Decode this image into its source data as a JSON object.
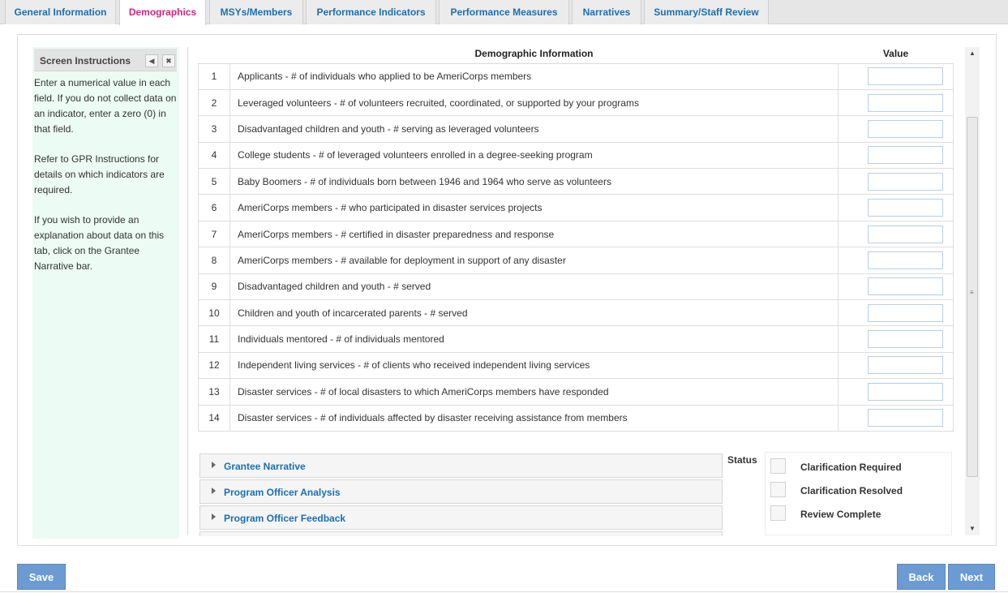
{
  "tabs": [
    {
      "label": "General Information",
      "active": false
    },
    {
      "label": "Demographics",
      "active": true
    },
    {
      "label": "MSYs/Members",
      "active": false
    },
    {
      "label": "Performance Indicators",
      "active": false
    },
    {
      "label": "Performance Measures",
      "active": false
    },
    {
      "label": "Narratives",
      "active": false
    },
    {
      "label": "Summary/Staff Review",
      "active": false
    }
  ],
  "instructions": {
    "title": "Screen Instructions",
    "paragraphs": [
      "Enter a numerical value in each field. If you do not collect data on an indicator, enter a zero (0) in that field.",
      "Refer to GPR Instructions for details on which indicators are required.",
      "If you wish to provide an explanation about data on this tab, click on the Grantee Narrative bar."
    ]
  },
  "table": {
    "header_info": "Demographic Information",
    "header_value": "Value",
    "rows": [
      {
        "num": "1",
        "desc": "Applicants - # of individuals who applied to be AmeriCorps members",
        "value": ""
      },
      {
        "num": "2",
        "desc": "Leveraged volunteers - # of volunteers recruited, coordinated, or supported by your programs",
        "value": ""
      },
      {
        "num": "3",
        "desc": "Disadvantaged children and youth - # serving as leveraged volunteers",
        "value": ""
      },
      {
        "num": "4",
        "desc": "College students - # of leveraged volunteers enrolled in a degree-seeking program",
        "value": ""
      },
      {
        "num": "5",
        "desc": "Baby Boomers - # of individuals born between 1946 and 1964 who serve as volunteers",
        "value": ""
      },
      {
        "num": "6",
        "desc": "AmeriCorps members - # who participated in disaster services projects",
        "value": ""
      },
      {
        "num": "7",
        "desc": "AmeriCorps members - # certified in disaster preparedness and response",
        "value": ""
      },
      {
        "num": "8",
        "desc": "AmeriCorps members - # available for deployment in support of any disaster",
        "value": ""
      },
      {
        "num": "9",
        "desc": "Disadvantaged children and youth - # served",
        "value": ""
      },
      {
        "num": "10",
        "desc": "Children and youth of incarcerated parents - # served",
        "value": ""
      },
      {
        "num": "11",
        "desc": "Individuals mentored - # of individuals mentored",
        "value": ""
      },
      {
        "num": "12",
        "desc": "Independent living services - # of clients who received independent living services",
        "value": ""
      },
      {
        "num": "13",
        "desc": "Disaster services - # of local disasters to which AmeriCorps members have responded",
        "value": ""
      },
      {
        "num": "14",
        "desc": "Disaster services - # of individuals affected by disaster receiving assistance from members",
        "value": ""
      }
    ]
  },
  "accordion": [
    {
      "label": "Grantee Narrative"
    },
    {
      "label": "Program Officer Analysis"
    },
    {
      "label": "Program Officer Feedback"
    }
  ],
  "status": {
    "label": "Status",
    "options": [
      {
        "label": "Clarification Required",
        "checked": false
      },
      {
        "label": "Clarification Resolved",
        "checked": false
      },
      {
        "label": "Review Complete",
        "checked": false
      }
    ]
  },
  "buttons": {
    "save": "Save",
    "back": "Back",
    "next": "Next"
  },
  "icons": {
    "collapse": "triangle-left-icon",
    "close": "close-icon",
    "expand": "triangle-right-icon",
    "scroll_up": "triangle-up-icon",
    "scroll_down": "triangle-down-icon"
  },
  "colors": {
    "accent_link": "#1a6fb5",
    "active_tab": "#d6247e",
    "instructions_bg": "#ecfbf3",
    "button_bg": "#6b9bd2"
  }
}
